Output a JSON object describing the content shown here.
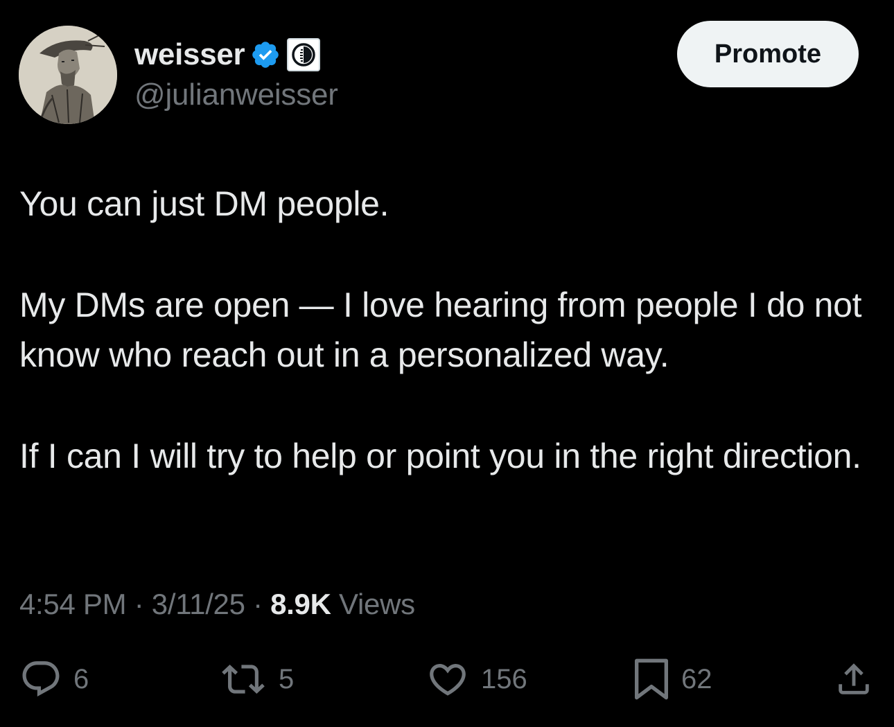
{
  "author": {
    "display_name": "weisser",
    "handle": "@julianweisser",
    "verified_icon": "verified-badge-icon",
    "affiliate_icon": "affiliate-badge-icon"
  },
  "header": {
    "promote_label": "Promote"
  },
  "tweet": {
    "paragraphs": [
      "You can just DM people.",
      "My DMs are open — I love hearing from people I do not know who reach out in a personalized way.",
      "If I can I will try to help or point you in the right direction."
    ],
    "time": "4:54 PM",
    "separator": "·",
    "date": "3/11/25",
    "views_count": "8.9K",
    "views_label": "Views"
  },
  "actions": {
    "replies": "6",
    "reposts": "5",
    "likes": "156",
    "bookmarks": "62",
    "icons": [
      "reply-icon",
      "repost-icon",
      "like-icon",
      "bookmark-icon",
      "share-icon"
    ]
  },
  "colors": {
    "background": "#000000",
    "primary_text": "#e7e9ea",
    "secondary_text": "#71767b",
    "verified_blue": "#1d9bf0",
    "button_bg": "#eff3f4"
  }
}
